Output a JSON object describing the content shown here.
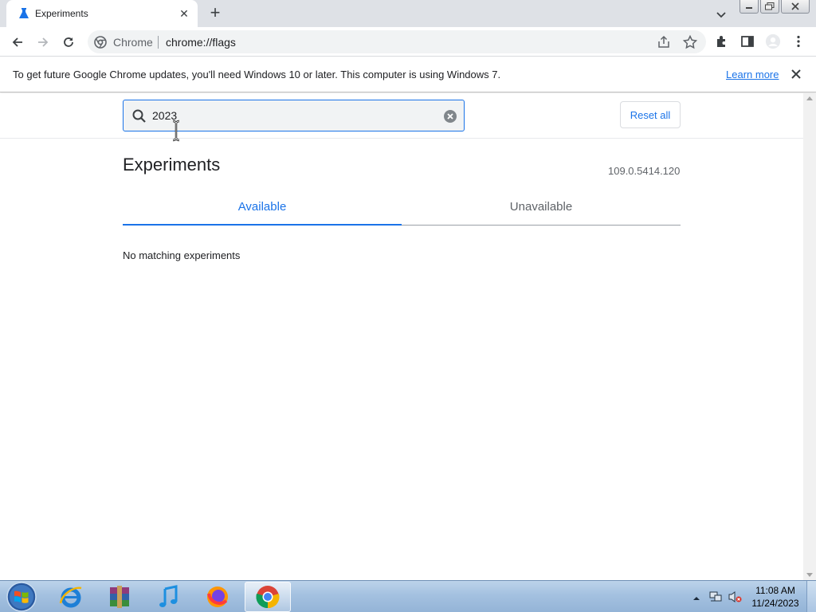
{
  "tab": {
    "title": "Experiments",
    "favicon": "flask-icon"
  },
  "toolbar": {
    "site_name": "Chrome",
    "url": "chrome://flags"
  },
  "infobar": {
    "message": "To get future Google Chrome updates, you'll need Windows 10 or later. This computer is using Windows 7.",
    "learn_more": "Learn more"
  },
  "search": {
    "value": "2023",
    "reset_label": "Reset all"
  },
  "page": {
    "heading": "Experiments",
    "version": "109.0.5414.120",
    "tabs": [
      {
        "label": "Available",
        "selected": true
      },
      {
        "label": "Unavailable",
        "selected": false
      }
    ],
    "empty_message": "No matching experiments"
  },
  "taskbar": {
    "apps": [
      "internet-explorer-icon",
      "winrar-icon",
      "itunes-icon",
      "firefox-icon",
      "chrome-icon"
    ],
    "time": "11:08 AM",
    "date": "11/24/2023"
  },
  "colors": {
    "accent": "#1a73e8",
    "tabstrip": "#dee1e6"
  }
}
